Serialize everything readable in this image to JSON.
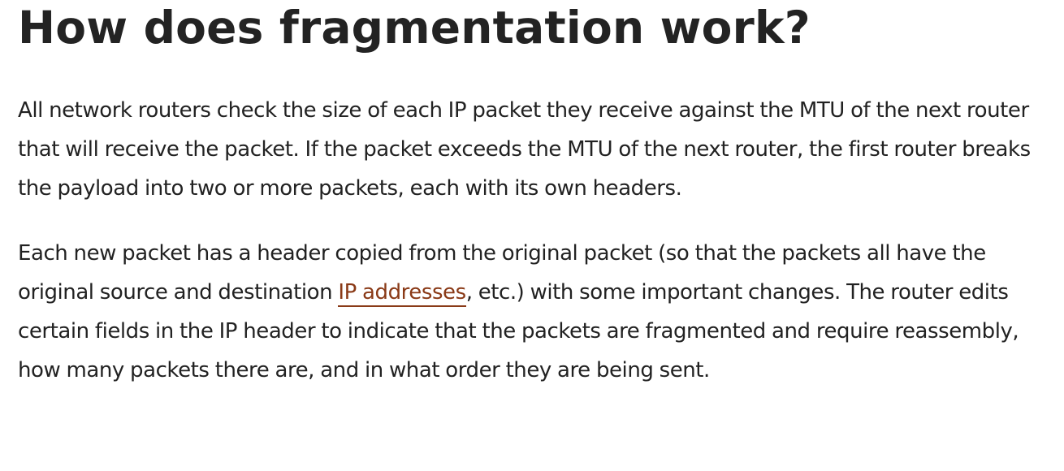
{
  "article": {
    "title": "How does fragmentation work?",
    "paragraph_1": "All network routers check the size of each IP packet they receive against the MTU of the next router that will receive the packet. If the packet exceeds the MTU of the next router, the first router breaks the payload into two or more packets, each with its own headers.",
    "paragraph_2": {
      "before_link": "Each new packet has a header copied from the original packet (so that the packets all have the original source and destination ",
      "link_text": "IP addresses",
      "after_link": ", etc.) with some important changes. The router edits certain fields in the IP header to indicate that the packets are fragmented and require reassembly, how many packets there are, and in what order they are being sent."
    }
  },
  "colors": {
    "text": "#222222",
    "heading": "#232323",
    "link": "#8a3a17",
    "background": "#ffffff"
  }
}
